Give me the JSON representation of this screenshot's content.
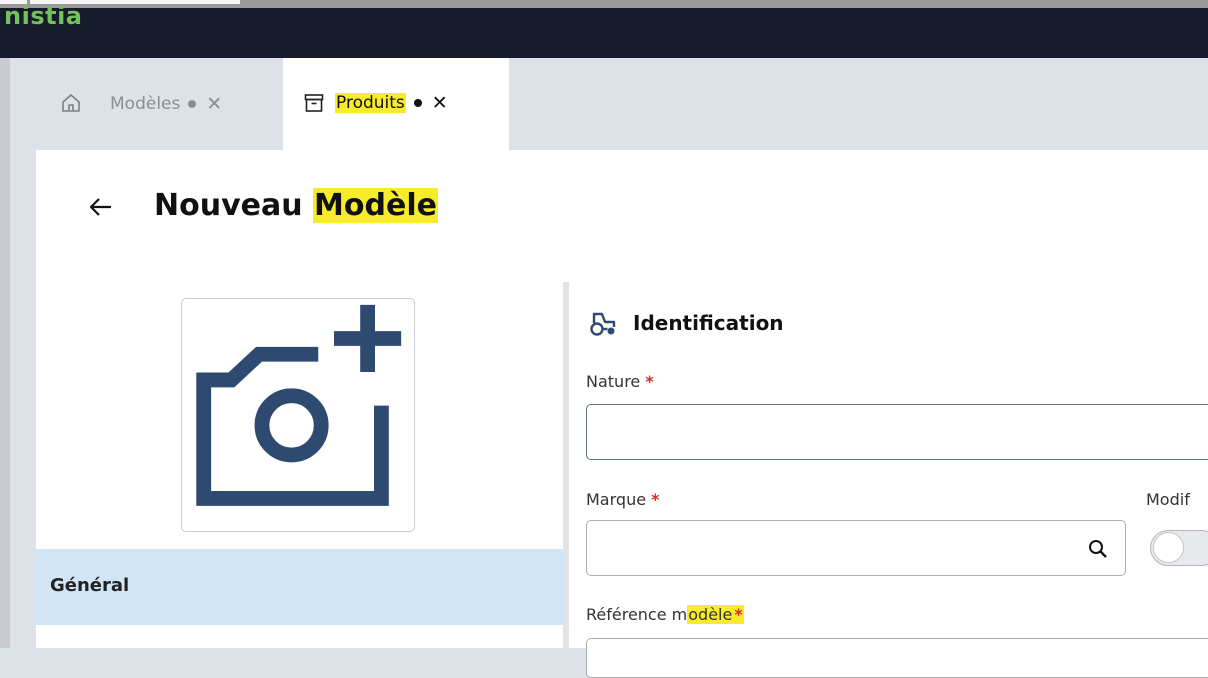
{
  "app": {
    "brand": "nistia"
  },
  "tabs": [
    {
      "label": "Modèles",
      "dot_color": "#8a8f97",
      "active": false,
      "icon": "home-icon"
    },
    {
      "label": "Produits",
      "dot_color": "#111111",
      "active": true,
      "icon": "archive-icon"
    }
  ],
  "page": {
    "title_prefix": "Nouveau ",
    "title_highlight": "Modèle"
  },
  "sidebar": {
    "items": [
      {
        "label": "Général",
        "active": true
      }
    ]
  },
  "section": {
    "title": "Identification",
    "icon": "tractor-icon"
  },
  "fields": {
    "nature": {
      "label": "Nature ",
      "required_mark": "*",
      "value": ""
    },
    "marque": {
      "label": "Marque ",
      "required_mark": "*",
      "value": ""
    },
    "modif": {
      "label": "Modif"
    },
    "reference": {
      "label_prefix": "Référence m",
      "label_highlight": "odèle",
      "required_mark": "*",
      "value": ""
    }
  },
  "colors": {
    "highlight": "#f8ec2a",
    "brand": "#74c05a",
    "active_nav": "#d2e5f6",
    "icon_blue": "#2f4a70",
    "required": "#d42b2b"
  }
}
